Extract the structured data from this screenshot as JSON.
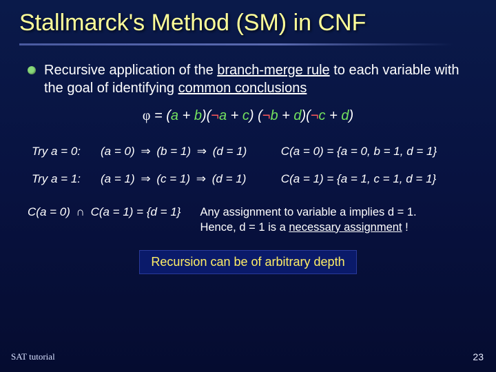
{
  "title": "Stallmarck's Method (SM) in CNF",
  "bullet": {
    "pre": "Recursive application of the ",
    "u1": "branch-merge rule",
    "mid": " to each variable with the goal of identifying ",
    "u2": "common conclusions"
  },
  "formula": {
    "phi": "φ",
    "eq": " = ",
    "t1a": "a",
    "t1b": "b",
    "n1": "¬",
    "t2a": "a",
    "t2b": "c",
    "n2": "¬",
    "t3a": "b",
    "t3b": "d",
    "n3": "¬",
    "t4a": "c",
    "t4b": "d"
  },
  "implies": " ⇒ ",
  "intersect": " ∩ ",
  "rows": [
    {
      "label": "Try a = 0:",
      "d": [
        "a = 0",
        "b = 1",
        "d = 1"
      ],
      "set": "C(a = 0) = {a = 0, b = 1, d = 1}"
    },
    {
      "label": "Try a = 1:",
      "d": [
        "a = 1",
        "c = 1",
        "d = 1"
      ],
      "set": "C(a = 1) = {a = 1, c = 1, d = 1}"
    }
  ],
  "conclusion": {
    "lhs_a": "C(a = 0)",
    "lhs_b": "C(a = 1)",
    "rhs": "{d = 1}",
    "expl_1": "Any assignment to variable a implies d = 1.",
    "expl_2a": "Hence, d = 1 is a ",
    "expl_2u": "necessary assignment",
    "expl_2b": " !"
  },
  "badge": "Recursion can be of arbitrary depth",
  "footer": {
    "left": "SAT  tutorial",
    "page": "23"
  }
}
